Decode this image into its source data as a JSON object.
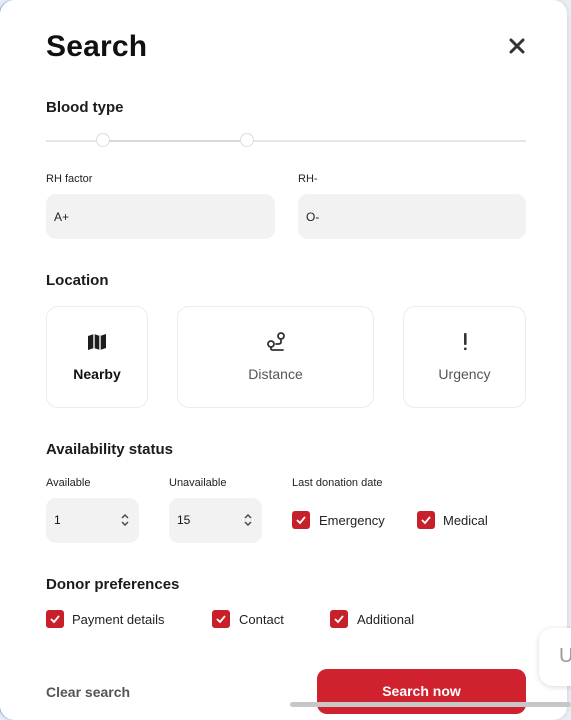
{
  "header": {
    "title": "Search"
  },
  "blood_type": {
    "heading": "Blood type",
    "rh_factor_label": "RH factor",
    "rh_factor_value": "A+",
    "rh_neg_label": "RH-",
    "rh_neg_value": "O-"
  },
  "location": {
    "heading": "Location",
    "options": [
      {
        "label": "Nearby",
        "icon": "map-icon",
        "selected": true
      },
      {
        "label": "Distance",
        "icon": "route-icon",
        "selected": false
      },
      {
        "label": "Urgency",
        "icon": "exclamation-icon",
        "selected": false
      }
    ]
  },
  "availability": {
    "heading": "Availability status",
    "available_label": "Available",
    "available_value": "1",
    "unavailable_label": "Unavailable",
    "unavailable_value": "15",
    "last_donation_label": "Last donation date",
    "emergency_label": "Emergency",
    "medical_label": "Medical"
  },
  "donor_preferences": {
    "heading": "Donor preferences",
    "payment_label": "Payment details",
    "contact_label": "Contact",
    "additional_label": "Additional"
  },
  "footer": {
    "clear_label": "Clear search",
    "search_label": "Search now"
  },
  "floating": {
    "label": "U"
  },
  "colors": {
    "accent": "#cf222e",
    "field_bg": "#f2f2f2"
  }
}
